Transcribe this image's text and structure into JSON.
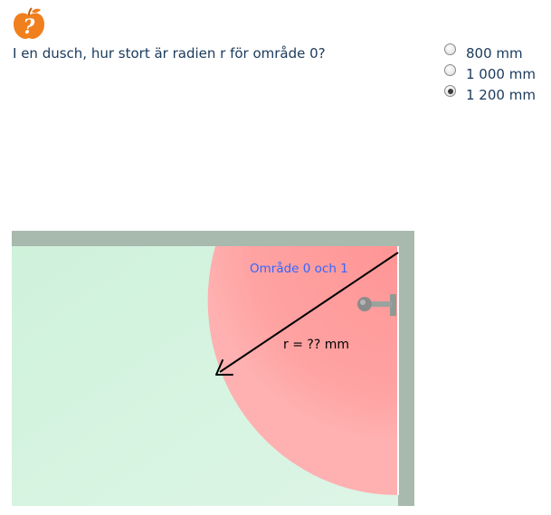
{
  "question": {
    "text": "I en dusch, hur stort är radien r för område 0?"
  },
  "help_icon": {
    "glyph": "?",
    "color": "#f07f1e"
  },
  "options": [
    {
      "label": "800 mm",
      "selected": false
    },
    {
      "label": "1 000 mm",
      "selected": false
    },
    {
      "label": "1 200 mm",
      "selected": true
    }
  ],
  "diagram": {
    "zone_label": "Område 0 och 1",
    "radius_label": "r = ?? mm",
    "colors": {
      "wall": "#a8b9ae",
      "floor": "#d2f2de",
      "zone": "#ff9d9d",
      "zone_label": "#3366ff",
      "arrow": "#000000"
    }
  }
}
